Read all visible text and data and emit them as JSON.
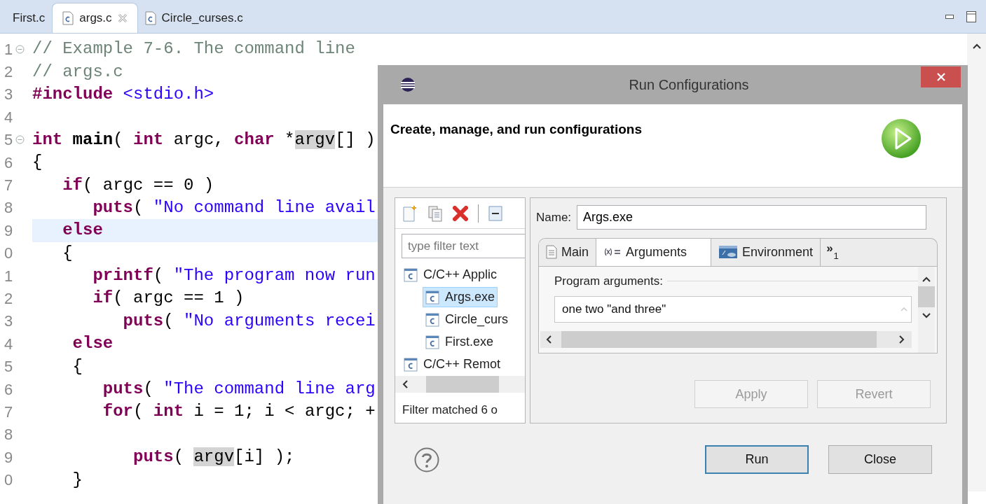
{
  "editor": {
    "tabs": [
      {
        "label": "First.c",
        "selected": false,
        "has_icon": false,
        "closable": false
      },
      {
        "label": "args.c",
        "selected": true,
        "has_icon": true,
        "closable": true
      },
      {
        "label": "Circle_curses.c",
        "selected": false,
        "has_icon": true,
        "closable": false
      }
    ],
    "lines": [
      {
        "number": "1",
        "collapsible": true,
        "current": false,
        "tokens": [
          {
            "kind": "comment",
            "text": "// Example 7-6. The command line"
          }
        ]
      },
      {
        "number": "2",
        "collapsible": false,
        "current": false,
        "tokens": [
          {
            "kind": "comment",
            "text": "// args.c"
          }
        ]
      },
      {
        "number": "3",
        "collapsible": false,
        "current": false,
        "tokens": [
          {
            "kind": "keyword",
            "text": "#include"
          },
          {
            "kind": "string",
            "text": " <stdio.h>"
          }
        ]
      },
      {
        "number": "4",
        "collapsible": false,
        "current": false
      },
      {
        "number": "5",
        "collapsible": true,
        "current": false,
        "tokens": [
          {
            "kind": "keyword",
            "text": "int"
          },
          {
            "kind": "function",
            "text": " main"
          },
          {
            "kind": "plain",
            "text": "( "
          },
          {
            "kind": "keyword",
            "text": "int"
          },
          {
            "kind": "plain",
            "text": " argc, "
          },
          {
            "kind": "keyword",
            "text": "char"
          },
          {
            "kind": "plain",
            "text": " *"
          },
          {
            "kind": "occurrence",
            "text": "argv"
          },
          {
            "kind": "plain",
            "text": "[] )"
          }
        ]
      },
      {
        "number": "6",
        "collapsible": false,
        "current": false,
        "tokens": [
          {
            "kind": "plain",
            "text": "{"
          }
        ]
      },
      {
        "number": "7",
        "collapsible": false,
        "current": false,
        "tokens": [
          {
            "kind": "keyword",
            "text": "   if"
          },
          {
            "kind": "plain",
            "text": "( argc == 0 )"
          }
        ]
      },
      {
        "number": "8",
        "collapsible": false,
        "current": false,
        "tokens": [
          {
            "kind": "keyword",
            "text": "      puts"
          },
          {
            "kind": "plain",
            "text": "( "
          },
          {
            "kind": "string",
            "text": "\"No command line avail"
          }
        ]
      },
      {
        "number": "9",
        "collapsible": false,
        "current": true,
        "tokens": [
          {
            "kind": "keyword",
            "text": "   else"
          }
        ]
      },
      {
        "number": "0",
        "collapsible": false,
        "current": false,
        "tokens": [
          {
            "kind": "plain",
            "text": "   {"
          }
        ]
      },
      {
        "number": "1",
        "collapsible": false,
        "current": false,
        "tokens": [
          {
            "kind": "keyword",
            "text": "      printf"
          },
          {
            "kind": "plain",
            "text": "( "
          },
          {
            "kind": "string",
            "text": "\"The program now run"
          }
        ]
      },
      {
        "number": "2",
        "collapsible": false,
        "current": false,
        "tokens": [
          {
            "kind": "keyword",
            "text": "      if"
          },
          {
            "kind": "plain",
            "text": "( argc == 1 )"
          }
        ]
      },
      {
        "number": "3",
        "collapsible": false,
        "current": false,
        "tokens": [
          {
            "kind": "keyword",
            "text": "         puts"
          },
          {
            "kind": "plain",
            "text": "( "
          },
          {
            "kind": "string",
            "text": "\"No arguments recei"
          }
        ]
      },
      {
        "number": "4",
        "collapsible": false,
        "current": false,
        "tokens": [
          {
            "kind": "keyword",
            "text": "    else"
          }
        ]
      },
      {
        "number": "5",
        "collapsible": false,
        "current": false,
        "tokens": [
          {
            "kind": "plain",
            "text": "    {"
          }
        ]
      },
      {
        "number": "6",
        "collapsible": false,
        "current": false,
        "tokens": [
          {
            "kind": "keyword",
            "text": "       puts"
          },
          {
            "kind": "plain",
            "text": "( "
          },
          {
            "kind": "string",
            "text": "\"The command line arg"
          }
        ]
      },
      {
        "number": "7",
        "collapsible": false,
        "current": false,
        "tokens": [
          {
            "kind": "keyword",
            "text": "       for"
          },
          {
            "kind": "plain",
            "text": "( "
          },
          {
            "kind": "keyword",
            "text": "int"
          },
          {
            "kind": "plain",
            "text": " i = 1; i < argc; +"
          }
        ]
      },
      {
        "number": "8",
        "collapsible": false,
        "current": false
      },
      {
        "number": "9",
        "collapsible": false,
        "current": false,
        "tokens": [
          {
            "kind": "keyword",
            "text": "          puts"
          },
          {
            "kind": "plain",
            "text": "( "
          },
          {
            "kind": "occurrence",
            "text": "argv"
          },
          {
            "kind": "plain",
            "text": "[i] );"
          }
        ]
      },
      {
        "number": "0",
        "collapsible": false,
        "current": false,
        "tokens": [
          {
            "kind": "plain",
            "text": "    }"
          }
        ]
      }
    ]
  },
  "dialog": {
    "title": "Run Configurations",
    "header": "Create, manage, and run configurations",
    "filter": {
      "placeholder": "type filter text"
    },
    "tree": [
      {
        "label": "C/C++ Applic",
        "selected": false,
        "children": [
          {
            "label": "Args.exe",
            "selected": true
          },
          {
            "label": "Circle_curs",
            "selected": false
          },
          {
            "label": "First.exe",
            "selected": false
          }
        ]
      },
      {
        "label": "C/C++ Remot",
        "selected": false
      }
    ],
    "filter_status": "Filter matched 6 o",
    "name_label": "Name:",
    "name_value": "Args.exe",
    "tabs": [
      {
        "label": "Main",
        "kind": "main",
        "selected": false
      },
      {
        "label": "Arguments",
        "kind": "arguments",
        "selected": true
      },
      {
        "label": "Environment",
        "kind": "environment",
        "selected": false
      }
    ],
    "more_tabs": {
      "symbol": "»",
      "count": "1"
    },
    "program_arguments": {
      "label": "Program arguments:",
      "value": "one two \"and three\""
    },
    "buttons": [
      {
        "label": "Apply",
        "disabled": true
      },
      {
        "label": "Revert",
        "disabled": true
      }
    ],
    "footer_buttons": [
      {
        "label": "Run",
        "default": true
      },
      {
        "label": "Close",
        "default": false
      }
    ]
  }
}
